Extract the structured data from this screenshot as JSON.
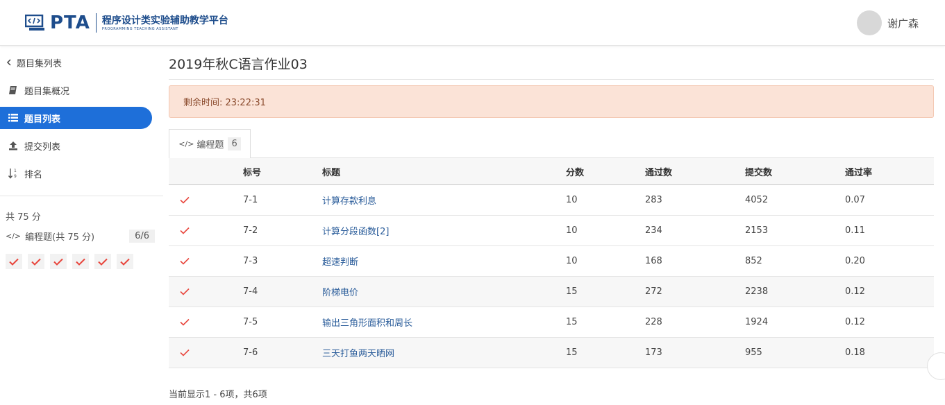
{
  "header": {
    "logo_text": "PTA",
    "platform_name": "程序设计类实验辅助教学平台",
    "platform_name_en": "PROGRAMMING TEACHING ASSISTANT",
    "user_name": "谢广森"
  },
  "sidebar": {
    "items": [
      {
        "label": "题目集列表",
        "icon": "chevron-left-icon"
      },
      {
        "label": "题目集概况",
        "icon": "book-icon"
      },
      {
        "label": "题目列表",
        "icon": "list-icon",
        "active": true
      },
      {
        "label": "提交列表",
        "icon": "upload-icon"
      },
      {
        "label": "排名",
        "icon": "sort-numeric-icon"
      }
    ],
    "total_score": "共 75 分",
    "category_label": "编程题(共 75 分)",
    "category_count": "6/6",
    "check_count": 6
  },
  "main": {
    "title": "2019年秋C语言作业03",
    "timer": "剩余时间: 23:22:31",
    "tab_label": "编程题",
    "tab_count": "6",
    "columns": [
      "",
      "标号",
      "标题",
      "分数",
      "通过数",
      "提交数",
      "通过率"
    ],
    "rows": [
      {
        "id": "7-1",
        "title": "计算存款利息",
        "score": "10",
        "passed": "283",
        "submitted": "4052",
        "rate": "0.07"
      },
      {
        "id": "7-2",
        "title": "计算分段函数[2]",
        "score": "10",
        "passed": "234",
        "submitted": "2153",
        "rate": "0.11"
      },
      {
        "id": "7-3",
        "title": "超速判断",
        "score": "10",
        "passed": "168",
        "submitted": "852",
        "rate": "0.20"
      },
      {
        "id": "7-4",
        "title": "阶梯电价",
        "score": "15",
        "passed": "272",
        "submitted": "2238",
        "rate": "0.12"
      },
      {
        "id": "7-5",
        "title": "输出三角形面积和周长",
        "score": "15",
        "passed": "228",
        "submitted": "1924",
        "rate": "0.12"
      },
      {
        "id": "7-6",
        "title": "三天打鱼两天晒网",
        "score": "15",
        "passed": "173",
        "submitted": "955",
        "rate": "0.18"
      }
    ],
    "footer": "当前显示1 - 6项，共6项"
  },
  "colors": {
    "brand": "#1e4d8c",
    "active": "#1e6fd9",
    "check": "#e8453c",
    "timer_bg": "#fbe3d7"
  }
}
